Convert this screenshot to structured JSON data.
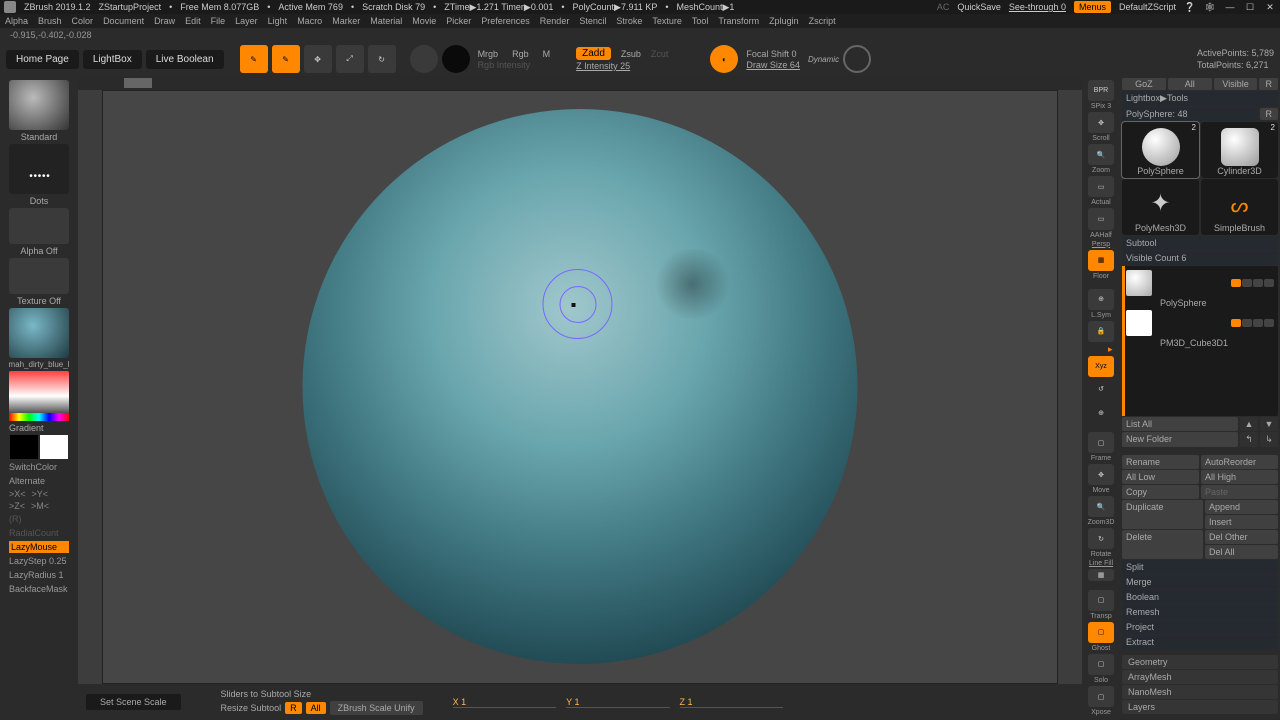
{
  "titlebar": {
    "app": "ZBrush 2019.1.2",
    "project": "ZStartupProject",
    "freemem": "Free Mem 8.077GB",
    "activemem": "Active Mem 769",
    "scratch": "Scratch Disk 79",
    "ztime": "ZTime▶1.271 Timer▶0.001",
    "polycount": "PolyCount▶7.911 KP",
    "meshcount": "MeshCount▶1",
    "ac": "AC",
    "quicksave": "QuickSave",
    "seethrough": "See-through  0",
    "menus": "Menus",
    "script": "DefaultZScript"
  },
  "menus": [
    "Alpha",
    "Brush",
    "Color",
    "Document",
    "Draw",
    "Edit",
    "File",
    "Layer",
    "Light",
    "Macro",
    "Marker",
    "Material",
    "Movie",
    "Picker",
    "Preferences",
    "Render",
    "Stencil",
    "Stroke",
    "Texture",
    "Tool",
    "Transform",
    "Zplugin",
    "Zscript"
  ],
  "coords": "-0.915,-0.402,-0.028",
  "toolbar": {
    "home": "Home Page",
    "lightbox": "LightBox",
    "liveboolean": "Live Boolean",
    "edit": "Edit",
    "draw": "Draw",
    "move": "Move",
    "scale": "Scale",
    "rotate": "Rotate",
    "mrgb": "Mrgb",
    "rgb": "Rgb",
    "m": "M",
    "rgbint": "Rgb Intensity",
    "zadd": "Zadd",
    "zsub": "Zsub",
    "zcut": "Zcut",
    "zint": "Z Intensity 25",
    "focal": "Focal Shift 0",
    "drawsize": "Draw Size 64",
    "dynamic": "Dynamic",
    "activepts": "ActivePoints: 5,789",
    "totalpts": "TotalPoints: 6,271"
  },
  "left": {
    "standard": "Standard",
    "dots": "Dots",
    "alpha": "Alpha Off",
    "texture": "Texture Off",
    "material": "mah_dirty_blue_l",
    "gradient": "Gradient",
    "switch": "SwitchColor",
    "alternate": "Alternate",
    "xp": ">X<",
    "yp": ">Y<",
    "zp": ">Z<",
    "mp": ">M<",
    "r": "(R)",
    "radial": "RadialCount",
    "lazymouse": "LazyMouse",
    "lazystep": "LazyStep 0.25",
    "lazyradius": "LazyRadius 1",
    "backface": "BackfaceMask"
  },
  "rightstrip": {
    "bpr": "BPR",
    "spix": "SPix 3",
    "scroll": "Scroll",
    "zoom": "Zoom",
    "actual": "Actual",
    "aahalfl": "AAHalf",
    "persp": "Persp",
    "floor": "Floor",
    "localsymm": "L.Sym",
    "lock": "🔒",
    "xyz": "Xyz",
    "compass1": "↺",
    "compass2": "⊕",
    "frame": "Frame",
    "move": "Move",
    "zoom3d": "Zoom3D",
    "rotate": "Rotate",
    "linefill": "Line Fill",
    "transp": "Transp",
    "ghost": "Ghost",
    "solo": "Solo",
    "xpose": "Xpose"
  },
  "right": {
    "goz": "GoZ",
    "all": "All",
    "visible": "Visible",
    "r": "R",
    "lightbox": "Lightbox▶Tools",
    "polysphere48": "PolySphere: 48",
    "r2": "R",
    "tools": [
      {
        "name": "PolySphere",
        "n": "2"
      },
      {
        "name": "Cylinder3D",
        "n": "2"
      },
      {
        "name": "PolyMesh3D",
        "n": ""
      },
      {
        "name": "SimpleBrush",
        "n": ""
      }
    ],
    "subtool": "Subtool",
    "visiblecount": "Visible Count 6",
    "subtools": [
      {
        "name": "PolySphere"
      },
      {
        "name": "PM3D_Cube3D1"
      }
    ],
    "listall": "List All",
    "newfolder": "New Folder",
    "rename": "Rename",
    "autoreorder": "AutoReorder",
    "alllow": "All Low",
    "allhigh": "All High",
    "copy": "Copy",
    "paste": "Paste",
    "duplicate": "Duplicate",
    "append": "Append",
    "insert": "Insert",
    "delete": "Delete",
    "delother": "Del Other",
    "delall": "Del All",
    "split": "Split",
    "merge": "Merge",
    "boolean": "Boolean",
    "remesh": "Remesh",
    "project": "Project",
    "extract": "Extract",
    "geometry": "Geometry",
    "arraymesh": "ArrayMesh",
    "nanomesh": "NanoMesh",
    "layers": "Layers"
  },
  "bottom": {
    "setscene": "Set Scene Scale",
    "sliders": "Sliders to Subtool Size",
    "resize": "Resize Subtool",
    "r": "R",
    "all": "All",
    "unify": "ZBrush Scale Unify",
    "x": "X 1",
    "y": "Y 1",
    "z": "Z 1"
  }
}
